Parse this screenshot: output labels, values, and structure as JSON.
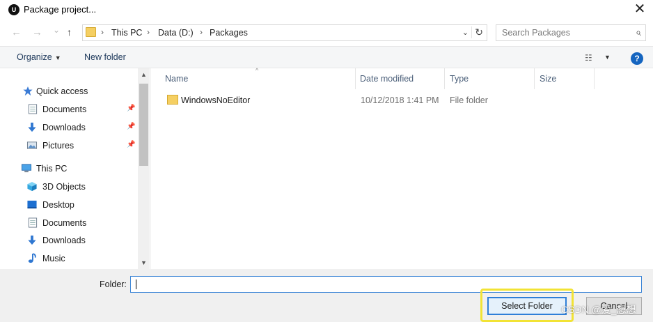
{
  "window": {
    "app_icon_text": "U",
    "title": "Package project...",
    "close_symbol": "✕"
  },
  "nav": {
    "back": "←",
    "forward": "→",
    "recent": "⌄",
    "up": "↑",
    "breadcrumb": [
      "This PC",
      "Data (D:)",
      "Packages"
    ],
    "separator": "›",
    "dropdown": "⌄",
    "refresh": "↻",
    "search_placeholder": "Search Packages",
    "search_symbol": "⌕"
  },
  "commandbar": {
    "organize": "Organize",
    "organize_caret": "▼",
    "new_folder": "New folder",
    "view_symbol": "☷",
    "view_caret": "▼",
    "help": "?"
  },
  "sidebar": {
    "items": [
      {
        "label": "Quick access",
        "icon": "star-icon",
        "pinned": false
      },
      {
        "label": "Documents",
        "icon": "documents-icon",
        "pinned": true
      },
      {
        "label": "Downloads",
        "icon": "downloads-icon",
        "pinned": true
      },
      {
        "label": "Pictures",
        "icon": "pictures-icon",
        "pinned": true
      },
      {
        "label": "This PC",
        "icon": "computer-icon",
        "pinned": false
      },
      {
        "label": "3D Objects",
        "icon": "cube-icon",
        "pinned": false
      },
      {
        "label": "Desktop",
        "icon": "desktop-icon",
        "pinned": false
      },
      {
        "label": "Documents",
        "icon": "documents-icon",
        "pinned": false
      },
      {
        "label": "Downloads",
        "icon": "downloads-icon",
        "pinned": false
      },
      {
        "label": "Music",
        "icon": "music-icon",
        "pinned": false
      }
    ],
    "pin_symbol": "📌"
  },
  "columns": {
    "name": "Name",
    "date": "Date modified",
    "type": "Type",
    "size": "Size",
    "sort_symbol": "^"
  },
  "files": [
    {
      "name": "WindowsNoEditor",
      "date": "10/12/2018 1:41 PM",
      "type": "File folder",
      "size": ""
    }
  ],
  "footer": {
    "folder_label": "Folder:",
    "folder_value": "",
    "select_button": "Select Folder",
    "cancel_button": "Cancel"
  },
  "watermark": "CSDN @爱_想想",
  "colors": {
    "accent": "#2e7fd8",
    "highlight": "#f2e335",
    "folder": "#f5cf62",
    "help": "#1565c0"
  }
}
